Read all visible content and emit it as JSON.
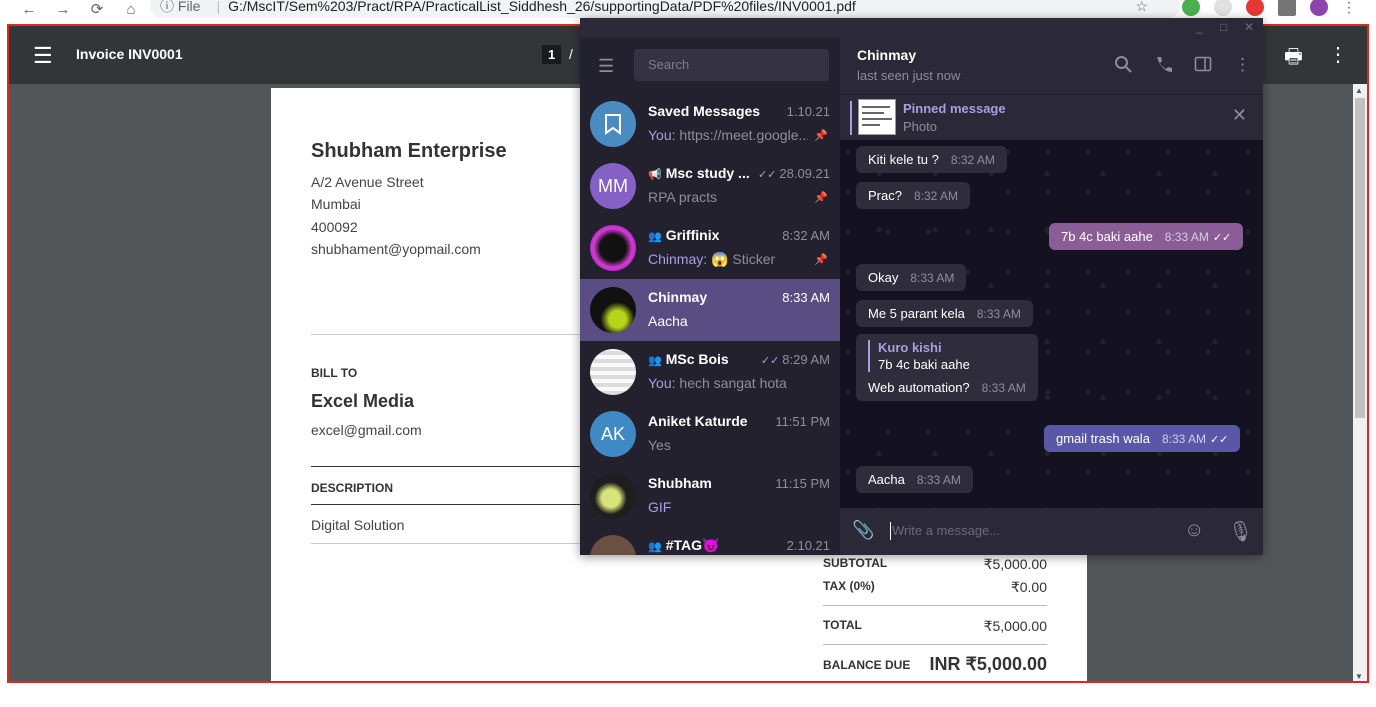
{
  "browser": {
    "back": "←",
    "forward": "→",
    "reload": "⟳",
    "home": "⌂",
    "info_label": "ⓘ File",
    "url": "G:/MscIT/Sem%203/Pract/RPA/PracticalList_Siddhesh_26/supportingData/PDF%20files/INV0001.pdf"
  },
  "pdf_viewer": {
    "title": "Invoice INV0001",
    "page_current": "1",
    "page_sep": "/"
  },
  "invoice": {
    "company": "Shubham Enterprise",
    "address1": "A/2 Avenue Street",
    "address2": "Mumbai",
    "address3": "400092",
    "email": "shubhament@yopmail.com",
    "bill_to_label": "BILL TO",
    "client": "Excel Media",
    "client_email": "excel@gmail.com",
    "description_label": "DESCRIPTION",
    "item": "Digital Solution",
    "subtotal_label": "SUBTOTAL",
    "subtotal": "₹5,000.00",
    "tax_label": "TAX (0%)",
    "tax": "₹0.00",
    "total_label": "TOTAL",
    "total": "₹5,000.00",
    "balance_label": "BALANCE DUE",
    "balance": "INR ₹5,000.00"
  },
  "telegram": {
    "search_placeholder": "Search",
    "chats": [
      {
        "name": "Saved Messages",
        "time": "1.10.21",
        "you": "You:",
        "preview": " https://meet.google...",
        "color": "#4a8bc2",
        "initials": "",
        "icon": "bookmark"
      },
      {
        "name": "Msc study ...",
        "time": "28.09.21",
        "you": "",
        "preview": "RPA practs",
        "color": "#8561c5",
        "initials": "MM",
        "icon": "megaphone"
      },
      {
        "name": "Griffinix",
        "time": "8:32 AM",
        "you": "Chinmay:",
        "preview": " 😱 Sticker",
        "color": "#8a2be2",
        "initials": "",
        "icon": "group"
      },
      {
        "name": "Chinmay",
        "time": "8:33 AM",
        "you": "",
        "preview": "Aacha",
        "color": "#1c1c1c",
        "initials": "",
        "icon": ""
      },
      {
        "name": "MSc Bois",
        "time": "8:29 AM",
        "you": "You:",
        "preview": " hech sangat hota",
        "color": "#eeeeee",
        "initials": "",
        "icon": "group"
      },
      {
        "name": "Aniket Katurde",
        "time": "11:51 PM",
        "you": "",
        "preview": "Yes",
        "color": "#3f8ac4",
        "initials": "AK",
        "icon": ""
      },
      {
        "name": "Shubham",
        "time": "11:15 PM",
        "you": "",
        "preview": "GIF",
        "color": "#222222",
        "initials": "",
        "icon": ""
      },
      {
        "name": "#TAG😈",
        "time": "2.10.21",
        "you": "",
        "preview": "",
        "color": "#6a5040",
        "initials": "",
        "icon": "group"
      }
    ],
    "header": {
      "name": "Chinmay",
      "status": "last seen just now"
    },
    "pinned": {
      "title": "Pinned message",
      "subtitle": "Photo"
    },
    "messages": [
      {
        "text": "Kiti kele tu ?",
        "time": "8:32 AM",
        "dir": "in"
      },
      {
        "text": "Prac?",
        "time": "8:32 AM",
        "dir": "in"
      },
      {
        "text": "7b 4c baki aahe",
        "time": "8:33 AM",
        "dir": "out"
      },
      {
        "text": "Okay",
        "time": "8:33 AM",
        "dir": "in"
      },
      {
        "text": "Me 5 parant kela",
        "time": "8:33 AM",
        "dir": "in"
      },
      {
        "reply_name": "Kuro kishi",
        "reply_text": "7b 4c baki aahe",
        "text": "Web automation?",
        "time": "8:33 AM",
        "dir": "in"
      },
      {
        "text": "gmail trash wala",
        "time": "8:33 AM",
        "dir": "out2"
      },
      {
        "text": "Aacha",
        "time": "8:33 AM",
        "dir": "in"
      }
    ],
    "composer_placeholder": "Write a message..."
  }
}
